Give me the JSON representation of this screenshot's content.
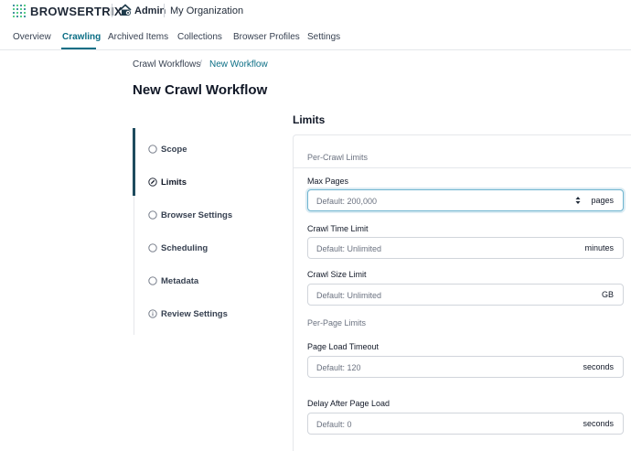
{
  "header": {
    "brand": "BROWSERTRIX",
    "admin_label": "Admin",
    "org_name": "My Organization",
    "logo_colors": [
      "#0b6e85",
      "#22c55e",
      "#0b6e85",
      "#22c55e"
    ]
  },
  "nav": {
    "tabs": [
      {
        "label": "Overview"
      },
      {
        "label": "Crawling",
        "active": true
      },
      {
        "label": "Archived Items"
      },
      {
        "label": "Collections"
      },
      {
        "label": "Browser Profiles"
      },
      {
        "label": "Settings"
      }
    ]
  },
  "breadcrumb": {
    "parent": "Crawl Workflows",
    "separator": "/",
    "current": "New Workflow"
  },
  "page": {
    "title": "New Crawl Workflow"
  },
  "steps": [
    {
      "label": "Scope",
      "icon": "circle-icon"
    },
    {
      "label": "Limits",
      "icon": "pencil-circle-icon",
      "active": true
    },
    {
      "label": "Browser Settings",
      "icon": "circle-icon"
    },
    {
      "label": "Scheduling",
      "icon": "circle-icon"
    },
    {
      "label": "Metadata",
      "icon": "circle-icon"
    },
    {
      "label": "Review Settings",
      "icon": "info-circle-icon"
    }
  ],
  "limits": {
    "heading": "Limits",
    "per_crawl_heading": "Per-Crawl Limits",
    "per_page_heading": "Per-Page Limits",
    "max_pages": {
      "label": "Max Pages",
      "placeholder": "Default: 200,000",
      "suffix": "pages"
    },
    "crawl_time": {
      "label": "Crawl Time Limit",
      "placeholder": "Default: Unlimited",
      "suffix": "minutes"
    },
    "crawl_size": {
      "label": "Crawl Size Limit",
      "placeholder": "Default: Unlimited",
      "suffix": "GB"
    },
    "page_load_timeout": {
      "label": "Page Load Timeout",
      "placeholder": "Default: 120",
      "suffix": "seconds"
    },
    "delay_after_load": {
      "label": "Delay After Page Load",
      "placeholder": "Default: 0",
      "suffix": "seconds"
    }
  },
  "colors": {
    "accent": "#0b6e85",
    "active_bar": "#1e4b5e",
    "focus_ring": "#6fb5d0"
  }
}
